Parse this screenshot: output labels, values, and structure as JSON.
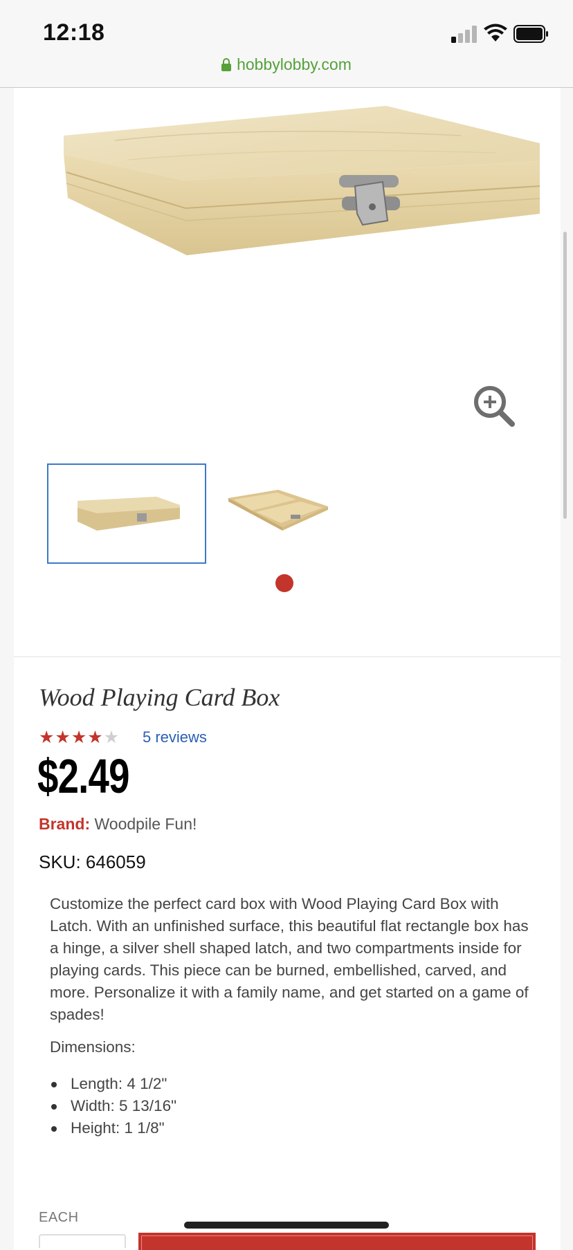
{
  "status_bar": {
    "time": "12:18",
    "url": "hobbylobby.com"
  },
  "gallery": {
    "thumbnails": [
      "card-box-closed",
      "card-box-open"
    ],
    "selected_index": 0
  },
  "product": {
    "title": "Wood Playing Card Box",
    "rating_stars": 4,
    "rating_max": 5,
    "reviews_link": "5 reviews",
    "price": "$2.49",
    "brand_label": "Brand:",
    "brand_value": "Woodpile Fun!",
    "sku": "SKU: 646059",
    "description": "Customize the perfect card box with Wood Playing Card Box with Latch. With an unfinished surface, this beautiful flat rectangle box has a hinge, a silver shell shaped latch, and two compartments inside for playing cards. This piece can be burned, embellished, carved, and more. Personalize it with a family name, and get started on a game of spades!",
    "dimensions_title": "Dimensions:",
    "dimensions": [
      "Length: 4 1/2\"",
      "Width: 5 13/16\"",
      "Height: 1 1/8\""
    ],
    "unit_label": "EACH"
  },
  "colors": {
    "accent": "#c3342c",
    "link": "#2b5fb3",
    "secure": "#55a13a",
    "selection": "#3d78c9"
  }
}
